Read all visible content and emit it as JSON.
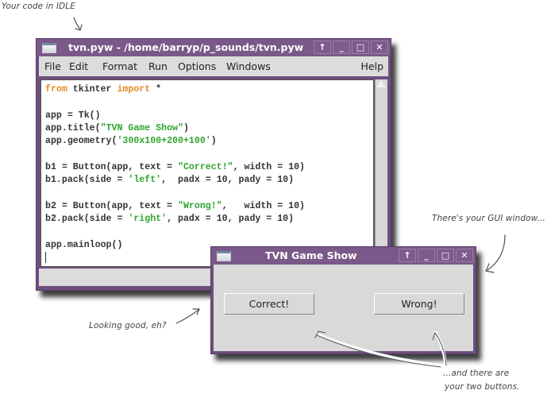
{
  "annotations": {
    "idle_label": "Your code in IDLE",
    "gui_label": "There's your GUI window...",
    "looking_good": "Looking good, eh?",
    "buttons_line1": "...and there are",
    "buttons_line2": "your two buttons."
  },
  "idle_window": {
    "title": "tvn.pyw - /home/barryp/p_sounds/tvn.pyw",
    "title_buttons": [
      "↑",
      "_",
      "□",
      "✕"
    ],
    "menu": [
      "File",
      "Edit",
      "Format",
      "Run",
      "Options",
      "Windows"
    ],
    "help": "Help",
    "code_lines": [
      [
        {
          "t": "from",
          "c": "kw"
        },
        {
          "t": " tkinter ",
          "c": ""
        },
        {
          "t": "import",
          "c": "kw"
        },
        {
          "t": " *",
          "c": ""
        }
      ],
      [],
      [
        {
          "t": "app = Tk()",
          "c": ""
        }
      ],
      [
        {
          "t": "app.title(",
          "c": ""
        },
        {
          "t": "\"TVN Game Show\"",
          "c": "str"
        },
        {
          "t": ")",
          "c": ""
        }
      ],
      [
        {
          "t": "app.geometry(",
          "c": ""
        },
        {
          "t": "'300x100+200+100'",
          "c": "str"
        },
        {
          "t": ")",
          "c": ""
        }
      ],
      [],
      [
        {
          "t": "b1 = Button(app, text = ",
          "c": ""
        },
        {
          "t": "\"Correct!\"",
          "c": "str"
        },
        {
          "t": ", width = 10)",
          "c": ""
        }
      ],
      [
        {
          "t": "b1.pack(side = ",
          "c": ""
        },
        {
          "t": "'left'",
          "c": "str"
        },
        {
          "t": ",  padx = 10, pady = 10)",
          "c": ""
        }
      ],
      [],
      [
        {
          "t": "b2 = Button(app, text = ",
          "c": ""
        },
        {
          "t": "\"Wrong!\"",
          "c": "str"
        },
        {
          "t": ",   width = 10)",
          "c": ""
        }
      ],
      [
        {
          "t": "b2.pack(side = ",
          "c": ""
        },
        {
          "t": "'right'",
          "c": "str"
        },
        {
          "t": ", padx = 10, pady = 10)",
          "c": ""
        }
      ],
      [],
      [
        {
          "t": "app.mainloop()",
          "c": ""
        }
      ]
    ]
  },
  "gui_window": {
    "title": "TVN Game Show",
    "title_buttons": [
      "↑",
      "_",
      "□",
      "✕"
    ],
    "buttons": [
      "Correct!",
      "Wrong!"
    ]
  }
}
